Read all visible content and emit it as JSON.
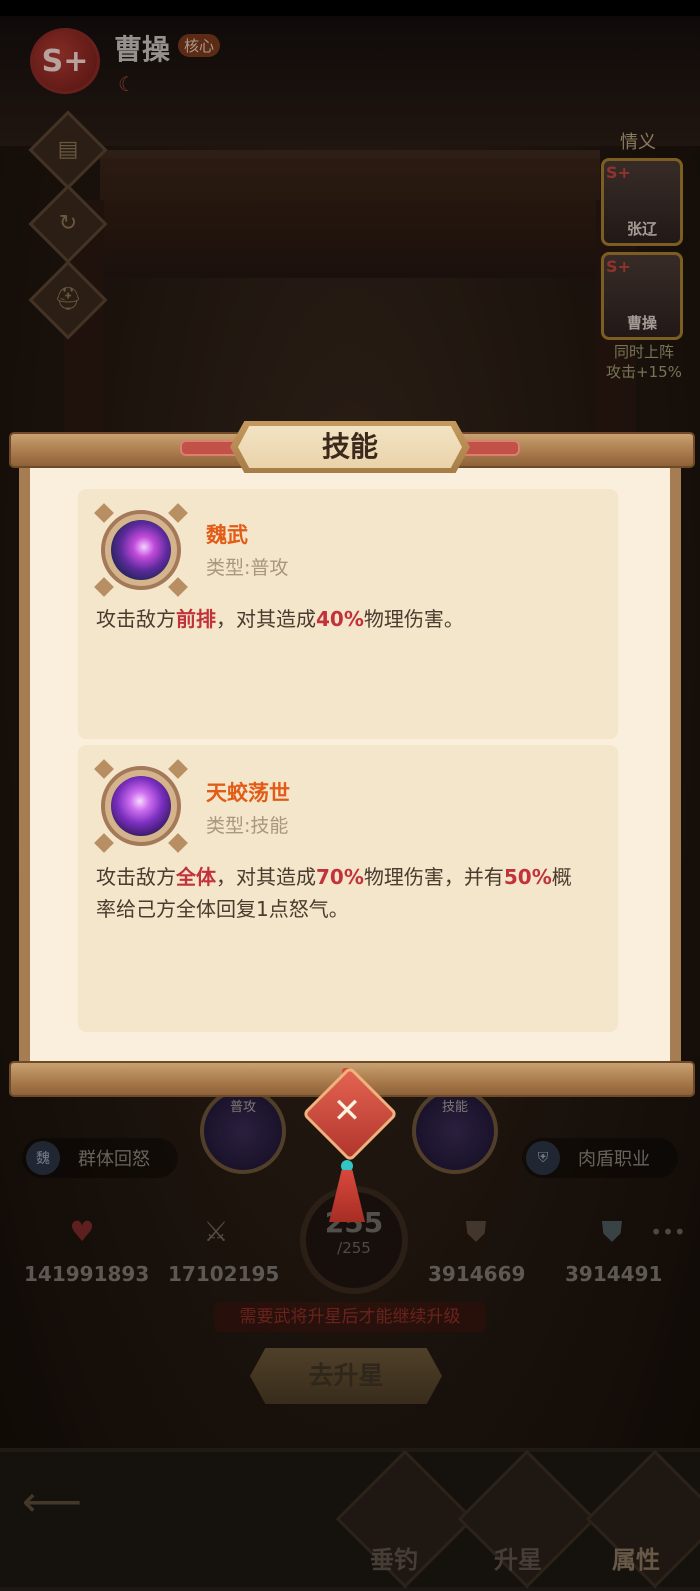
{
  "hero": {
    "rank": "S+",
    "name": "曹操",
    "tag": "核心"
  },
  "bond": {
    "title": "情义",
    "cards": [
      {
        "rank": "S+",
        "name": "张辽"
      },
      {
        "rank": "S+",
        "name": "曹操"
      }
    ],
    "effect_line1": "同时上阵",
    "effect_line2": "攻击+15%"
  },
  "modal": {
    "title": "技能",
    "skills": [
      {
        "name": "魏武",
        "type_label": "类型:普攻",
        "desc_1": "攻击敌方",
        "desc_hl1": "前排",
        "desc_2": "，对其造成",
        "desc_hl2": "40%",
        "desc_3": "物理伤害。"
      },
      {
        "name": "天蛟荡世",
        "type_label": "类型:技能",
        "desc_1": "攻击敌方",
        "desc_hl1": "全体",
        "desc_2": "，对其造成",
        "desc_hl2": "70%",
        "desc_3": "物理伤害，并有",
        "desc_hl3": "50%",
        "desc_4": "概率给己方全体回复1点怒气。"
      }
    ]
  },
  "background_ui": {
    "left_pill_icon": "魏",
    "left_pill": "群体回怒",
    "right_pill": "肉盾职业",
    "skill_orb_1": "普攻",
    "skill_orb_2": "技能",
    "level_current": "255",
    "level_max": "/255",
    "stats": [
      "141991893",
      "17102195",
      "3914669",
      "3914491"
    ],
    "warning": "需要武将升星后才能继续升级",
    "upgrade_button": "去升星"
  },
  "nav": {
    "items": [
      "垂钓",
      "升星",
      "属性"
    ]
  },
  "colors": {
    "highlight": "#c2323a",
    "skill_name": "#e25c17",
    "paper": "#f9efdc"
  }
}
